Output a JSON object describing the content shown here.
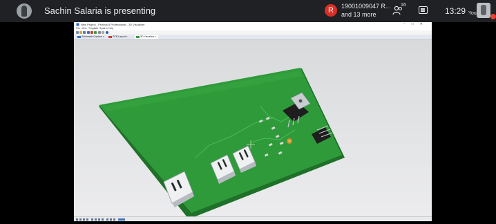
{
  "meeting": {
    "presenter_text": "Sachin Salaria is presenting",
    "participant_initial": "R",
    "participant_name": "19001009047 R...",
    "participant_more": "and 13 more",
    "people_count": "16",
    "clock": "13:29",
    "you_label": "You"
  },
  "window": {
    "title": "New Project - Proteus 8 Professional - 3D Visualizer",
    "menu": [
      "File",
      "View",
      "Template",
      "System",
      "Help"
    ],
    "tabs": [
      "Schematic Capture",
      "PCB Layout",
      "3D Visualizer"
    ],
    "active_tab": "3D Visualizer"
  },
  "colors": {
    "board": "#2f9a3a",
    "board_edge": "#1f7029",
    "meet_bar": "#202124",
    "record": "#d93025"
  }
}
